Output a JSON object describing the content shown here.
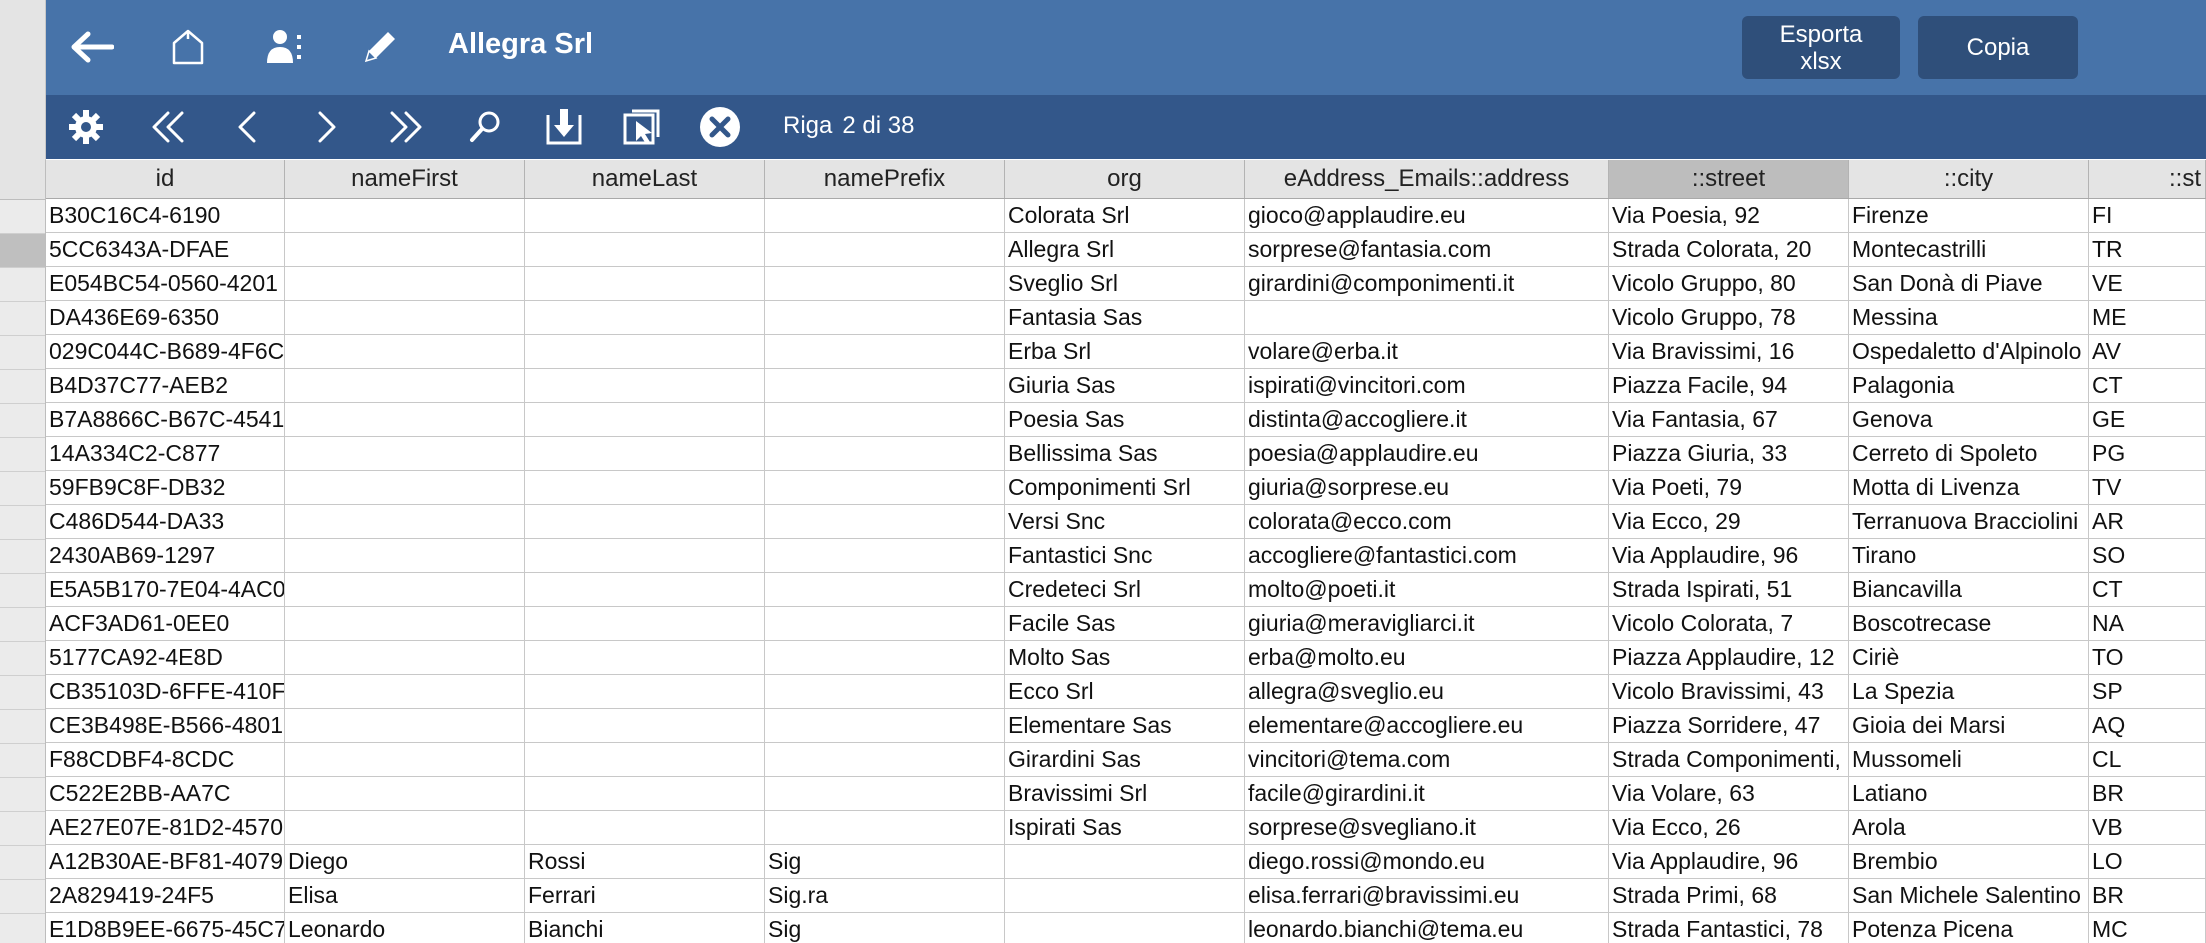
{
  "toolbar": {
    "title": "Allegra Srl",
    "export_label_line1": "Esporta",
    "export_label_line2": "xlsx",
    "copy_label": "Copia",
    "icons": [
      "back-arrow-icon",
      "home-icon",
      "contacts-icon",
      "pencil-icon"
    ]
  },
  "nav": {
    "icons": [
      "gear-icon",
      "first-record-icon",
      "previous-record-icon",
      "next-record-icon",
      "last-record-icon",
      "search-icon",
      "import-icon",
      "select-icon",
      "close-icon"
    ],
    "record_label": "Riga",
    "record_position": "2 di 38"
  },
  "colors": {
    "topbar": "#4773a9",
    "navbar": "#33578a",
    "button": "#2f4f7a"
  },
  "table": {
    "columns": [
      "id",
      "nameFirst",
      "nameLast",
      "namePrefix",
      "org",
      "eAddress_Emails::address",
      "::street",
      "::city",
      "::st"
    ],
    "sorted_column": "::street",
    "current_row": 1,
    "rows": [
      [
        "B30C16C4-6190",
        "",
        "",
        "",
        "Colorata Srl",
        "gioco@applaudire.eu",
        "Via Poesia, 92",
        "Firenze",
        "FI"
      ],
      [
        "5CC6343A-DFAE",
        "",
        "",
        "",
        "Allegra Srl",
        "sorprese@fantasia.com",
        "Strada Colorata, 20",
        "Montecastrilli",
        "TR"
      ],
      [
        "E054BC54-0560-4201",
        "",
        "",
        "",
        "Sveglio Srl",
        "girardini@componimenti.it",
        "Vicolo Gruppo, 80",
        "San Donà di Piave",
        "VE"
      ],
      [
        "DA436E69-6350",
        "",
        "",
        "",
        "Fantasia Sas",
        "",
        "Vicolo Gruppo, 78",
        "Messina",
        "ME"
      ],
      [
        "029C044C-B689-4F6C",
        "",
        "",
        "",
        "Erba Srl",
        "volare@erba.it",
        "Via Bravissimi, 16",
        "Ospedaletto d'Alpinolo",
        "AV"
      ],
      [
        "B4D37C77-AEB2",
        "",
        "",
        "",
        "Giuria Sas",
        "ispirati@vincitori.com",
        "Piazza Facile, 94",
        "Palagonia",
        "CT"
      ],
      [
        "B7A8866C-B67C-4541",
        "",
        "",
        "",
        "Poesia Sas",
        "distinta@accogliere.it",
        "Via Fantasia, 67",
        "Genova",
        "GE"
      ],
      [
        "14A334C2-C877",
        "",
        "",
        "",
        "Bellissima Sas",
        "poesia@applaudire.eu",
        "Piazza Giuria, 33",
        "Cerreto di Spoleto",
        "PG"
      ],
      [
        "59FB9C8F-DB32",
        "",
        "",
        "",
        "Componimenti Srl",
        "giuria@sorprese.eu",
        "Via Poeti, 79",
        "Motta di Livenza",
        "TV"
      ],
      [
        "C486D544-DA33",
        "",
        "",
        "",
        "Versi Snc",
        "colorata@ecco.com",
        "Via Ecco, 29",
        "Terranuova Bracciolini",
        "AR"
      ],
      [
        "2430AB69-1297",
        "",
        "",
        "",
        "Fantastici Snc",
        "accogliere@fantastici.com",
        "Via Applaudire, 96",
        "Tirano",
        "SO"
      ],
      [
        "E5A5B170-7E04-4AC0",
        "",
        "",
        "",
        "Credeteci Srl",
        "molto@poeti.it",
        "Strada Ispirati, 51",
        "Biancavilla",
        "CT"
      ],
      [
        "ACF3AD61-0EE0",
        "",
        "",
        "",
        "Facile Sas",
        "giuria@meravigliarci.it",
        "Vicolo Colorata, 7",
        "Boscotrecase",
        "NA"
      ],
      [
        "5177CA92-4E8D",
        "",
        "",
        "",
        "Molto Sas",
        "erba@molto.eu",
        "Piazza Applaudire, 12",
        "Ciriè",
        "TO"
      ],
      [
        "CB35103D-6FFE-410F",
        "",
        "",
        "",
        "Ecco Srl",
        "allegra@sveglio.eu",
        "Vicolo Bravissimi, 43",
        "La Spezia",
        "SP"
      ],
      [
        "CE3B498E-B566-4801",
        "",
        "",
        "",
        "Elementare Sas",
        "elementare@accogliere.eu",
        "Piazza Sorridere, 47",
        "Gioia dei Marsi",
        "AQ"
      ],
      [
        "F88CDBF4-8CDC",
        "",
        "",
        "",
        "Girardini Sas",
        "vincitori@tema.com",
        "Strada Componimenti,",
        "Mussomeli",
        "CL"
      ],
      [
        "C522E2BB-AA7C",
        "",
        "",
        "",
        "Bravissimi Srl",
        "facile@girardini.it",
        "Via Volare, 63",
        "Latiano",
        "BR"
      ],
      [
        "AE27E07E-81D2-4570",
        "",
        "",
        "",
        "Ispirati Sas",
        "sorprese@svegliano.it",
        "Via Ecco, 26",
        "Arola",
        "VB"
      ],
      [
        "A12B30AE-BF81-4079",
        "Diego",
        "Rossi",
        "Sig",
        "",
        "diego.rossi@mondo.eu",
        "Via Applaudire, 96",
        "Brembio",
        "LO"
      ],
      [
        "2A829419-24F5",
        "Elisa",
        "Ferrari",
        "Sig.ra",
        "",
        "elisa.ferrari@bravissimi.eu",
        "Strada Primi, 68",
        "San Michele Salentino",
        "BR"
      ],
      [
        "E1D8B9EE-6675-45C7",
        "Leonardo",
        "Bianchi",
        "Sig",
        "",
        "leonardo.bianchi@tema.eu",
        "Strada Fantastici, 78",
        "Potenza Picena",
        "MC"
      ]
    ]
  }
}
